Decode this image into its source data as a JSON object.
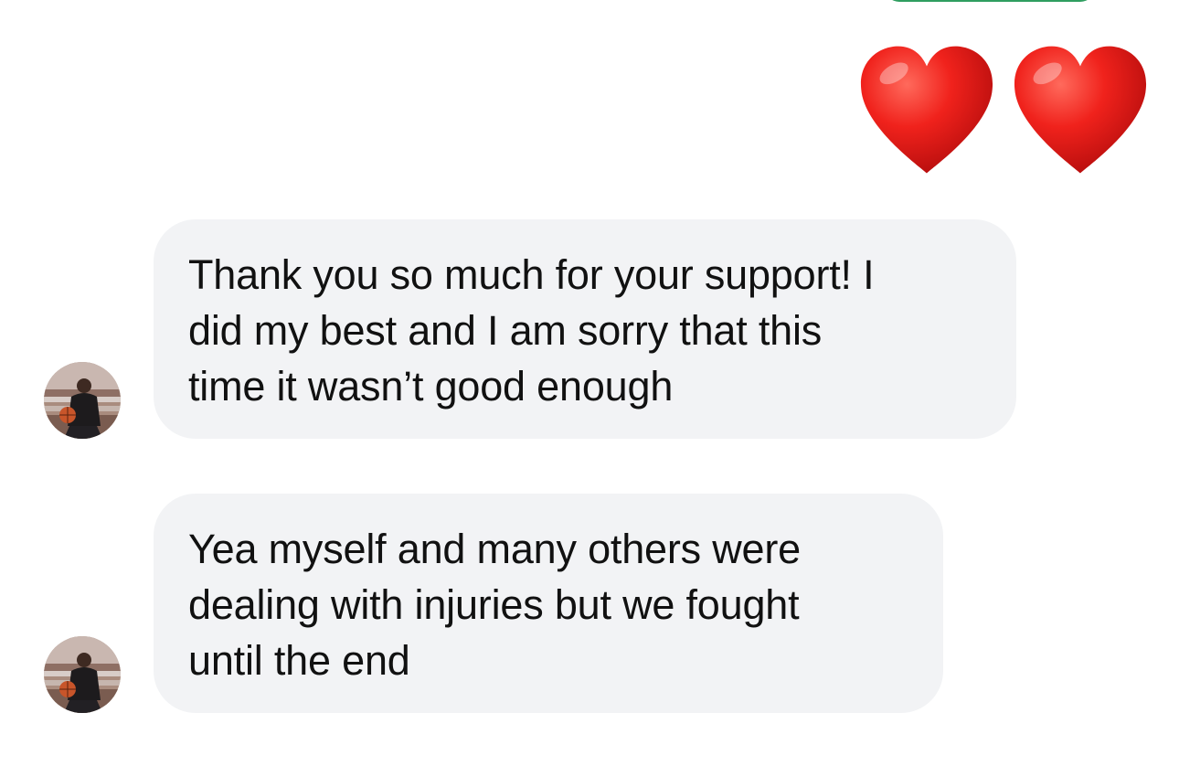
{
  "colors": {
    "sent_bubble": "#2f9e60",
    "received_bubble": "#f2f3f5",
    "text": "#111111",
    "background": "#ffffff",
    "heart": "#e81c1c"
  },
  "reaction": {
    "icons": [
      "red-heart-icon",
      "red-heart-icon"
    ]
  },
  "messages": [
    {
      "sender_avatar": "avatar",
      "lines": [
        "Thank you so much for your support! I",
        "did my best and I am sorry that this",
        "time it wasn’t good enough"
      ]
    },
    {
      "sender_avatar": "avatar",
      "lines": [
        "Yea myself and many others were",
        "dealing with injuries but we fought",
        "until the end"
      ]
    }
  ]
}
